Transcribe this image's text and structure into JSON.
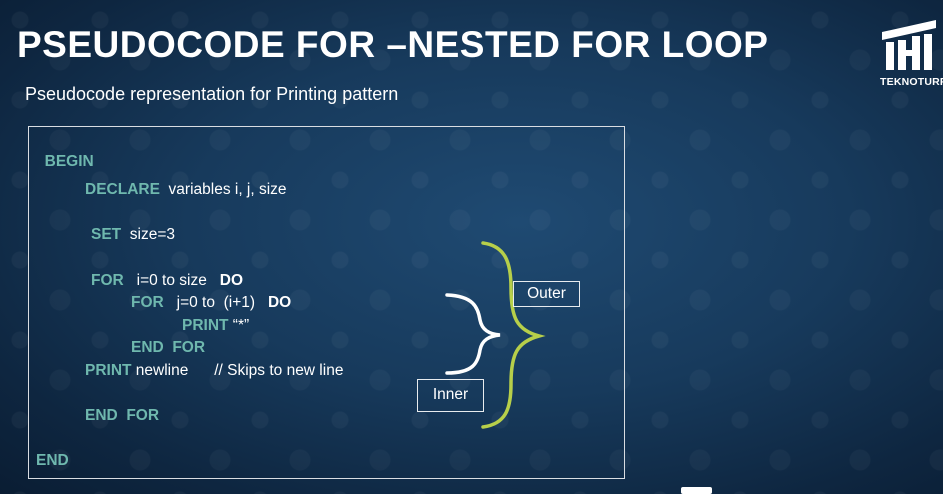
{
  "slide": {
    "title": "PSEUDOCODE FOR –NESTED FOR LOOP",
    "subtitle": "Pseudocode representation for Printing pattern"
  },
  "logo": {
    "text": "TEKNOTURF",
    "icon": "teknoturf-logo-icon"
  },
  "code": {
    "begin": "BEGIN",
    "declare_kw": "DECLARE",
    "declare_rest": "  variables i, j, size",
    "set_kw": "SET",
    "set_rest": "  size=3",
    "for1_kw": "FOR",
    "for1_rest": "   i=0 to size   ",
    "for1_do": "DO",
    "for2_kw": "FOR",
    "for2_rest": "   j=0 to  (i+1)   ",
    "for2_do": "DO",
    "print1_kw": "PRINT",
    "print1_rest": " “*”",
    "endfor_inner": "END  FOR",
    "print2_kw": "PRINT",
    "print2_rest": " newline      // Skips to new line",
    "endfor_outer": "END  FOR",
    "end": "END"
  },
  "annotations": {
    "outer_label": "Outer",
    "inner_label": "Inner"
  },
  "colors": {
    "keyword": "#6fb8ae",
    "outer_brace": "#b7cf4a",
    "inner_brace": "#ffffff"
  }
}
